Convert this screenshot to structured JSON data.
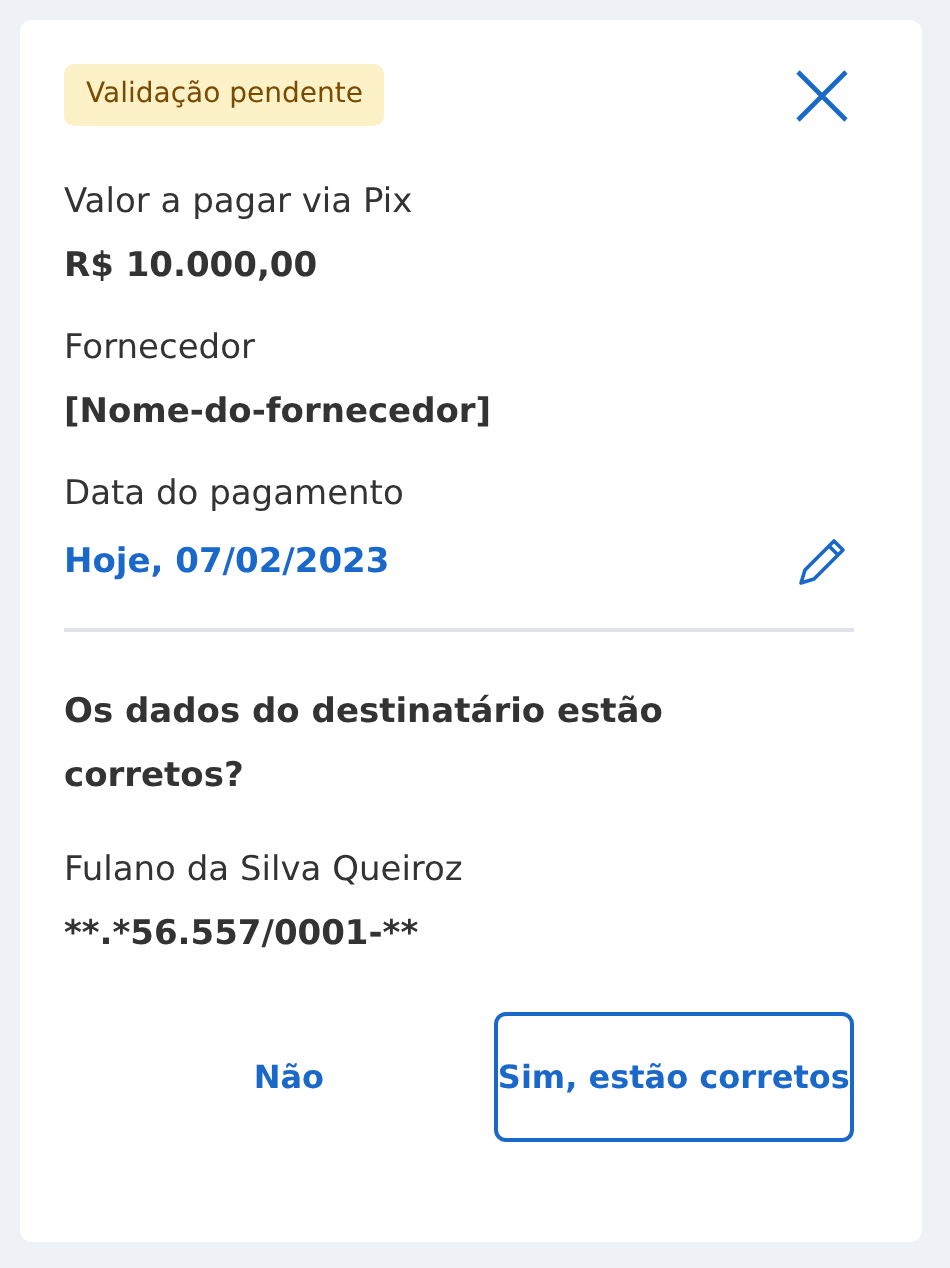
{
  "badge": "Validação pendente",
  "fields": [
    {
      "label": "Valor a pagar via Pix",
      "value": "R$ 10.000,00",
      "kind": "plain"
    },
    {
      "label": "Fornecedor",
      "value": "[Nome-do-fornecedor]",
      "kind": "plain"
    },
    {
      "label": "Data do pagamento",
      "value": "Hoje, 07/02/2023",
      "kind": "editable"
    }
  ],
  "question": "Os dados do destinatário estão corretos?",
  "recipient": {
    "name": "Fulano da Silva Queiroz",
    "document": "**.*56.557/0001-**"
  },
  "buttons": [
    {
      "label": "Não",
      "kind": "text"
    },
    {
      "label": "Sim, estão corretos",
      "kind": "outlined"
    }
  ]
}
